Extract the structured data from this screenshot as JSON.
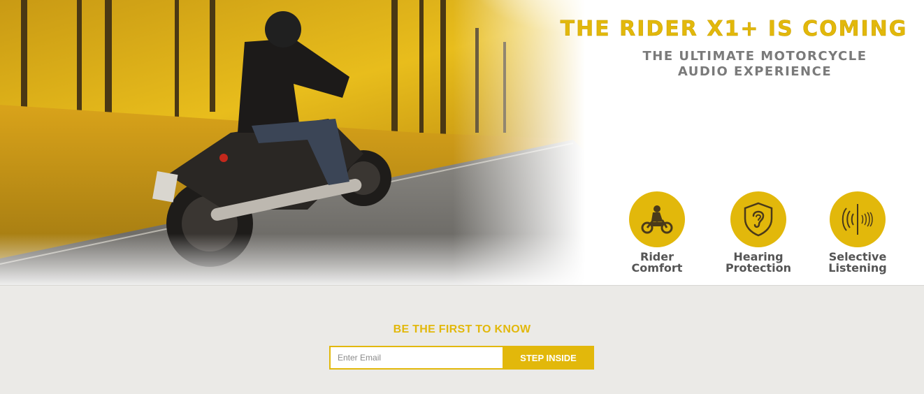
{
  "hero": {
    "headline": "THE RIDER X1+ IS COMING",
    "subheadline_line1": "THE ULTIMATE MOTORCYCLE",
    "subheadline_line2": "AUDIO EXPERIENCE",
    "image_subject": "motorcyclist-riding-through-autumn-forest"
  },
  "features": [
    {
      "label_line1": "Rider",
      "label_line2": "Comfort",
      "icon": "motorcycle-rider-icon"
    },
    {
      "label_line1": "Hearing",
      "label_line2": "Protection",
      "icon": "ear-shield-icon"
    },
    {
      "label_line1": "Selective",
      "label_line2": "Listening",
      "icon": "sound-waves-icon"
    }
  ],
  "signup": {
    "title": "BE THE FIRST TO KNOW",
    "email_placeholder": "Enter Email",
    "email_value": "",
    "button_label": "STEP INSIDE"
  },
  "colors": {
    "accent": "#e2b80b",
    "subheadline": "#7a7a7a",
    "feature_label": "#555555",
    "signup_background": "#ebeae7"
  }
}
